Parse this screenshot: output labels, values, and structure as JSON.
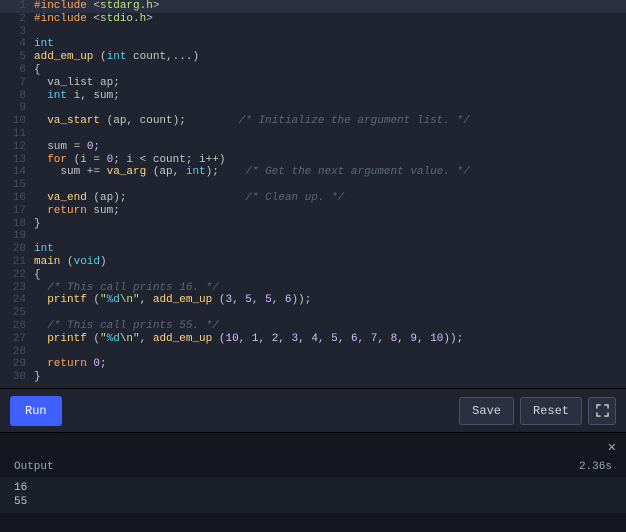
{
  "code": [
    {
      "n": 1,
      "hl": true,
      "tokens": [
        {
          "t": "#include",
          "c": "kw"
        },
        {
          "t": " <",
          "c": "punct"
        },
        {
          "t": "stdarg.h",
          "c": "inc"
        },
        {
          "t": ">",
          "c": "punct"
        }
      ]
    },
    {
      "n": 2,
      "tokens": [
        {
          "t": "#include",
          "c": "kw"
        },
        {
          "t": " <",
          "c": "punct"
        },
        {
          "t": "stdio.h",
          "c": "inc"
        },
        {
          "t": ">",
          "c": "punct"
        }
      ]
    },
    {
      "n": 3,
      "tokens": []
    },
    {
      "n": 4,
      "tokens": [
        {
          "t": "int",
          "c": "type"
        }
      ]
    },
    {
      "n": 5,
      "tokens": [
        {
          "t": "add_em_up",
          "c": "fn"
        },
        {
          "t": " (",
          "c": "punct"
        },
        {
          "t": "int",
          "c": "type"
        },
        {
          "t": " count,...)",
          "c": "punct"
        }
      ]
    },
    {
      "n": 6,
      "tokens": [
        {
          "t": "{",
          "c": "punct"
        }
      ]
    },
    {
      "n": 7,
      "tokens": [
        {
          "t": "  va_list ap;",
          "c": "punct"
        }
      ]
    },
    {
      "n": 8,
      "tokens": [
        {
          "t": "  ",
          "c": "punct"
        },
        {
          "t": "int",
          "c": "type"
        },
        {
          "t": " i, sum;",
          "c": "punct"
        }
      ]
    },
    {
      "n": 9,
      "tokens": []
    },
    {
      "n": 10,
      "tokens": [
        {
          "t": "  ",
          "c": "punct"
        },
        {
          "t": "va_start",
          "c": "fn"
        },
        {
          "t": " (ap, count);        ",
          "c": "punct"
        },
        {
          "t": "/* Initialize the argument list. */",
          "c": "comment"
        }
      ]
    },
    {
      "n": 11,
      "tokens": []
    },
    {
      "n": 12,
      "tokens": [
        {
          "t": "  sum = ",
          "c": "punct"
        },
        {
          "t": "0",
          "c": "num"
        },
        {
          "t": ";",
          "c": "punct"
        }
      ]
    },
    {
      "n": 13,
      "tokens": [
        {
          "t": "  ",
          "c": "punct"
        },
        {
          "t": "for",
          "c": "kw"
        },
        {
          "t": " (i = ",
          "c": "punct"
        },
        {
          "t": "0",
          "c": "num"
        },
        {
          "t": "; i < count; i++)",
          "c": "punct"
        }
      ]
    },
    {
      "n": 14,
      "tokens": [
        {
          "t": "    sum += ",
          "c": "punct"
        },
        {
          "t": "va_arg",
          "c": "fn"
        },
        {
          "t": " (ap, ",
          "c": "punct"
        },
        {
          "t": "int",
          "c": "type"
        },
        {
          "t": ");    ",
          "c": "punct"
        },
        {
          "t": "/* Get the next argument value. */",
          "c": "comment"
        }
      ]
    },
    {
      "n": 15,
      "tokens": []
    },
    {
      "n": 16,
      "tokens": [
        {
          "t": "  ",
          "c": "punct"
        },
        {
          "t": "va_end",
          "c": "fn"
        },
        {
          "t": " (ap);                  ",
          "c": "punct"
        },
        {
          "t": "/* Clean up. */",
          "c": "comment"
        }
      ]
    },
    {
      "n": 17,
      "tokens": [
        {
          "t": "  ",
          "c": "punct"
        },
        {
          "t": "return",
          "c": "kw"
        },
        {
          "t": " sum;",
          "c": "punct"
        }
      ]
    },
    {
      "n": 18,
      "tokens": [
        {
          "t": "}",
          "c": "punct"
        }
      ]
    },
    {
      "n": 19,
      "tokens": []
    },
    {
      "n": 20,
      "tokens": [
        {
          "t": "int",
          "c": "type"
        }
      ]
    },
    {
      "n": 21,
      "tokens": [
        {
          "t": "main",
          "c": "fn"
        },
        {
          "t": " (",
          "c": "punct"
        },
        {
          "t": "void",
          "c": "type"
        },
        {
          "t": ")",
          "c": "punct"
        }
      ]
    },
    {
      "n": 22,
      "tokens": [
        {
          "t": "{",
          "c": "punct"
        }
      ]
    },
    {
      "n": 23,
      "tokens": [
        {
          "t": "  ",
          "c": "punct"
        },
        {
          "t": "/* This call prints 16. */",
          "c": "comment"
        }
      ]
    },
    {
      "n": 24,
      "tokens": [
        {
          "t": "  ",
          "c": "punct"
        },
        {
          "t": "printf",
          "c": "fn"
        },
        {
          "t": " (",
          "c": "punct"
        },
        {
          "t": "\"",
          "c": "str"
        },
        {
          "t": "%d",
          "c": "fmt"
        },
        {
          "t": "\\n\"",
          "c": "str"
        },
        {
          "t": ", ",
          "c": "punct"
        },
        {
          "t": "add_em_up",
          "c": "fn"
        },
        {
          "t": " (",
          "c": "punct"
        },
        {
          "t": "3",
          "c": "num"
        },
        {
          "t": ", ",
          "c": "punct"
        },
        {
          "t": "5",
          "c": "num"
        },
        {
          "t": ", ",
          "c": "punct"
        },
        {
          "t": "5",
          "c": "num"
        },
        {
          "t": ", ",
          "c": "punct"
        },
        {
          "t": "6",
          "c": "num"
        },
        {
          "t": "));",
          "c": "punct"
        }
      ]
    },
    {
      "n": 25,
      "tokens": []
    },
    {
      "n": 26,
      "tokens": [
        {
          "t": "  ",
          "c": "punct"
        },
        {
          "t": "/* This call prints 55. */",
          "c": "comment"
        }
      ]
    },
    {
      "n": 27,
      "tokens": [
        {
          "t": "  ",
          "c": "punct"
        },
        {
          "t": "printf",
          "c": "fn"
        },
        {
          "t": " (",
          "c": "punct"
        },
        {
          "t": "\"",
          "c": "str"
        },
        {
          "t": "%d",
          "c": "fmt"
        },
        {
          "t": "\\n\"",
          "c": "str"
        },
        {
          "t": ", ",
          "c": "punct"
        },
        {
          "t": "add_em_up",
          "c": "fn"
        },
        {
          "t": " (",
          "c": "punct"
        },
        {
          "t": "10",
          "c": "num"
        },
        {
          "t": ", ",
          "c": "punct"
        },
        {
          "t": "1",
          "c": "num"
        },
        {
          "t": ", ",
          "c": "punct"
        },
        {
          "t": "2",
          "c": "num"
        },
        {
          "t": ", ",
          "c": "punct"
        },
        {
          "t": "3",
          "c": "num"
        },
        {
          "t": ", ",
          "c": "punct"
        },
        {
          "t": "4",
          "c": "num"
        },
        {
          "t": ", ",
          "c": "punct"
        },
        {
          "t": "5",
          "c": "num"
        },
        {
          "t": ", ",
          "c": "punct"
        },
        {
          "t": "6",
          "c": "num"
        },
        {
          "t": ", ",
          "c": "punct"
        },
        {
          "t": "7",
          "c": "num"
        },
        {
          "t": ", ",
          "c": "punct"
        },
        {
          "t": "8",
          "c": "num"
        },
        {
          "t": ", ",
          "c": "punct"
        },
        {
          "t": "9",
          "c": "num"
        },
        {
          "t": ", ",
          "c": "punct"
        },
        {
          "t": "10",
          "c": "num"
        },
        {
          "t": "));",
          "c": "punct"
        }
      ]
    },
    {
      "n": 28,
      "tokens": []
    },
    {
      "n": 29,
      "tokens": [
        {
          "t": "  ",
          "c": "punct"
        },
        {
          "t": "return",
          "c": "kw"
        },
        {
          "t": " ",
          "c": "punct"
        },
        {
          "t": "0",
          "c": "num"
        },
        {
          "t": ";",
          "c": "punct"
        }
      ]
    },
    {
      "n": 30,
      "tokens": [
        {
          "t": "}",
          "c": "punct"
        }
      ]
    }
  ],
  "toolbar": {
    "run_label": "Run",
    "save_label": "Save",
    "reset_label": "Reset"
  },
  "output": {
    "title": "Output",
    "time": "2.36s",
    "lines": [
      "16",
      "55"
    ]
  }
}
